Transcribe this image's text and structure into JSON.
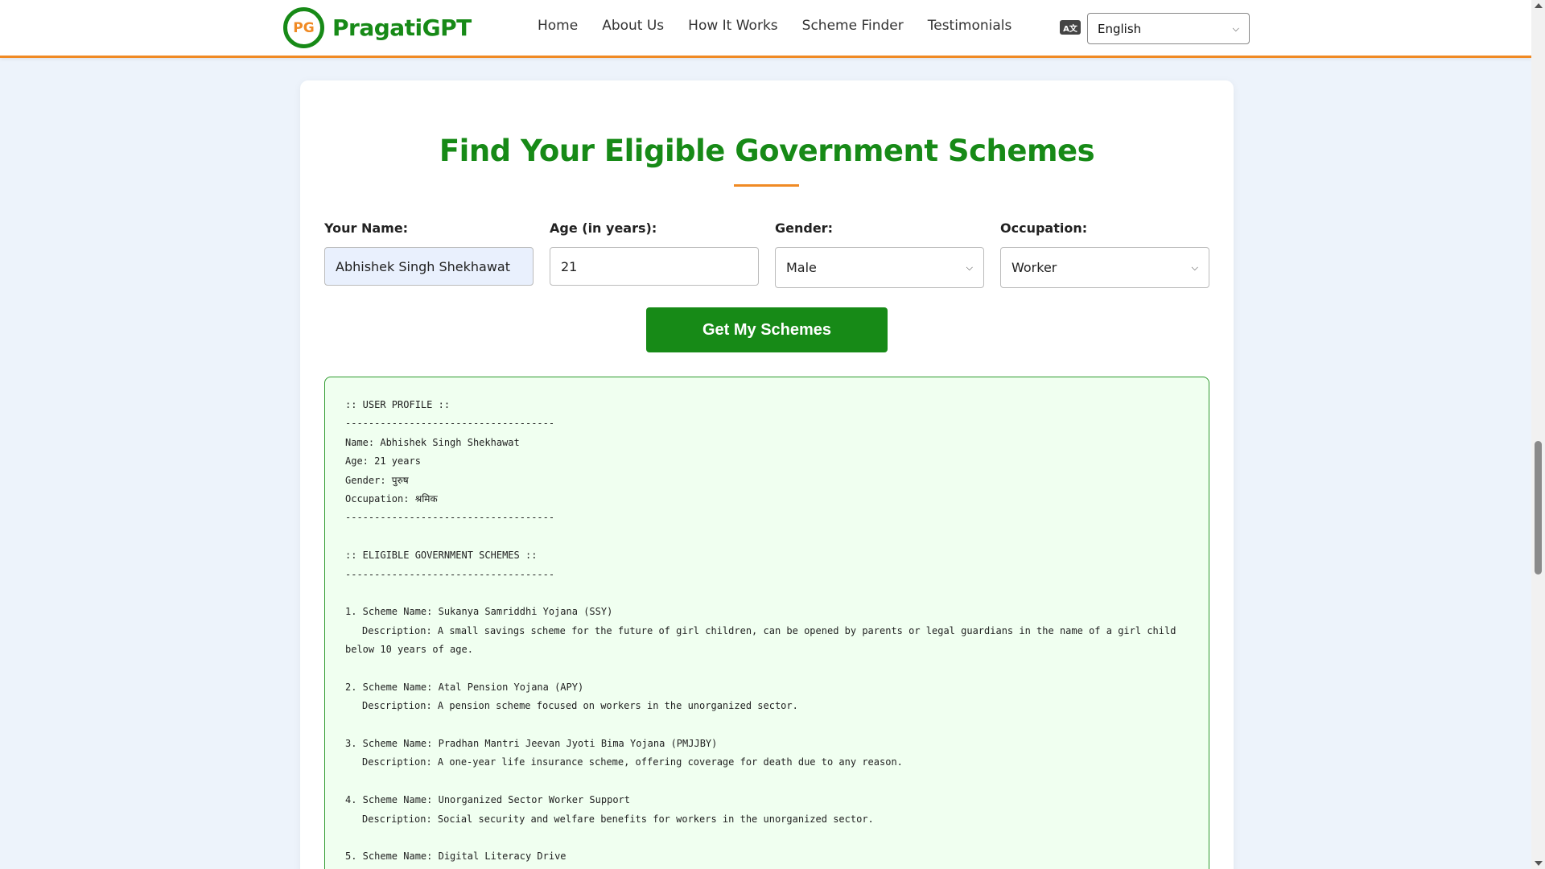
{
  "header": {
    "logo_badge": "PG",
    "logo_text": "PragatiGPT",
    "nav": [
      "Home",
      "About Us",
      "How It Works",
      "Scheme Finder",
      "Testimonials"
    ],
    "language": {
      "icon": "translate-icon",
      "selected": "English"
    }
  },
  "colors": {
    "brand_green": "#178a17",
    "accent_orange": "#f08a24",
    "result_bg": "#f0fff0"
  },
  "main": {
    "title": "Find Your Eligible Government Schemes",
    "form": {
      "name_label": "Your Name:",
      "name_value": "Abhishek Singh Shekhawat",
      "age_label": "Age (in years):",
      "age_value": "21",
      "gender_label": "Gender:",
      "gender_value": "Male",
      "occupation_label": "Occupation:",
      "occupation_value": "Worker",
      "submit_label": "Get My Schemes"
    },
    "result": {
      "profile_heading": ":: USER PROFILE ::",
      "divider": "------------------------------------",
      "name_line": "Name: Abhishek Singh Shekhawat",
      "age_line": "Age: 21 years",
      "gender_line": "Gender: पुरुष",
      "occupation_line": "Occupation: श्रमिक",
      "schemes_heading": ":: ELIGIBLE GOVERNMENT SCHEMES ::",
      "schemes": [
        {
          "name": "1. Scheme Name: Sukanya Samriddhi Yojana (SSY)",
          "description_1": "Description: A small savings scheme for the future of girl children, can be opened by parents or legal guardians in the name of a girl child",
          "description_2": "below 10 years of age."
        },
        {
          "name": "2. Scheme Name: Atal Pension Yojana (APY)",
          "description_1": "Description: A pension scheme focused on workers in the unorganized sector."
        },
        {
          "name": "3. Scheme Name: Pradhan Mantri Jeevan Jyoti Bima Yojana (PMJJBY)",
          "description_1": "Description: A one-year life insurance scheme, offering coverage for death due to any reason."
        },
        {
          "name": "4. Scheme Name: Unorganized Sector Worker Support",
          "description_1": "Description: Social security and welfare benefits for workers in the unorganized sector."
        },
        {
          "name": "5. Scheme Name: Digital Literacy Drive"
        }
      ]
    }
  }
}
